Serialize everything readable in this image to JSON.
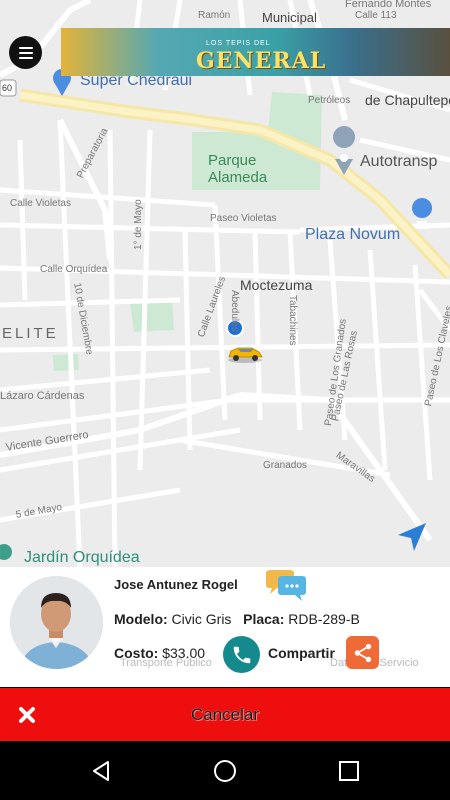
{
  "map": {
    "labels": {
      "calle_113": "Calle 113",
      "fernando_montes": "Fernando Montes",
      "municipal": "Municipal",
      "ramon": "Ramón",
      "super_chedraui": "Super Chedraui",
      "petroleos": "Petróleos",
      "chapultepec": "de Chapultepec",
      "parque_alameda": "Parque\nAlameda",
      "autotransp": "Autotransp",
      "preparatoria": "Preparatoria",
      "calle_violetas": "Calle Violetas",
      "paseo_violetas": "Paseo Violetas",
      "plaza_novum": "Plaza Novum",
      "moctezuma": "Moctezuma",
      "calle_orquidea": "Calle Orquídea",
      "diez_diciembre": "10 de Diciembre",
      "primero_mayo": "1° de Mayo",
      "calle_laureles": "Calle Laureles",
      "abedules": "Abedules",
      "tabachines": "Tabachines",
      "paseo_granados": "Paseo de Los Granados",
      "paseo_rosas": "Paseo de Las Rosas",
      "paseo_claveles": "Paseo de Los Claveles",
      "elite": "ELITE",
      "lazaro_cardenas": "Lázaro Cárdenas",
      "vicente_guerrero": "Vicente Guerrero",
      "granados": "Granados",
      "maravillas": "Maravillas",
      "cinco_mayo": "5 de Mayo",
      "jardin_orquidea": "Jardín Orquídea",
      "route_60": "60"
    }
  },
  "banner": {
    "subtitle": "LOS TEPIS DEL",
    "title": "GENERAL"
  },
  "driver": {
    "name": "Jose Antunez Rogel",
    "model_label": "Modelo:",
    "model_value": "Civic Gris",
    "plate_label": "Placa:",
    "plate_value": "RDB-289-B",
    "cost_label": "Costo:",
    "cost_value": "$33.00",
    "share_label": "Compartir"
  },
  "ghost_text": {
    "left": "Transporte Público",
    "right": "Datos del Servicio"
  },
  "cancel": {
    "label": "Cancelar"
  },
  "colors": {
    "cancel_bar": "#ee0e0e",
    "call_button": "#148a8e",
    "share_button": "#f06a37",
    "user_location": "#1e6fd9",
    "taxi": "#f4b400"
  },
  "icons": {
    "menu": "hamburger-menu-icon",
    "chat": "chat-bubbles-icon",
    "phone": "phone-icon",
    "share": "share-icon",
    "close": "close-icon",
    "back": "back-triangle-icon",
    "home": "home-circle-icon",
    "recents": "recents-square-icon",
    "navigation": "navigation-arrow-icon",
    "taxi": "taxi-car-icon"
  }
}
